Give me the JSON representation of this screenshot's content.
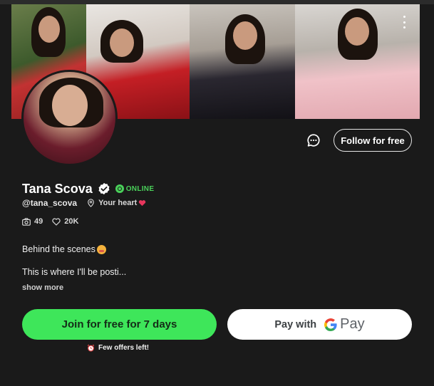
{
  "profile": {
    "name": "Tana Scova",
    "status": "ONLINE",
    "handle": "@tana_scova",
    "location": "Your heart"
  },
  "stats": {
    "media_count": "49",
    "likes_count": "20K"
  },
  "actions": {
    "follow_label": "Follow for free",
    "join_label": "Join for free for 7 days",
    "pay_with_label": "Pay with",
    "pay_brand": "Pay"
  },
  "bio": {
    "line1": "Behind the scenes",
    "line2": "This is where I'll be posti...",
    "show_more": "show more"
  },
  "offers": {
    "text": "Few offers left!"
  },
  "colors": {
    "background": "#1a1a1a",
    "accent_green": "#3ee65a",
    "online_green": "#4ad05a"
  },
  "icons": [
    "menu-dots-icon",
    "chat-icon",
    "verified-check-icon",
    "online-dot-icon",
    "location-pin-icon",
    "heart-emoji-icon",
    "camera-icon",
    "heart-icon",
    "blush-emoji-icon",
    "alarm-clock-icon",
    "google-g-icon"
  ]
}
